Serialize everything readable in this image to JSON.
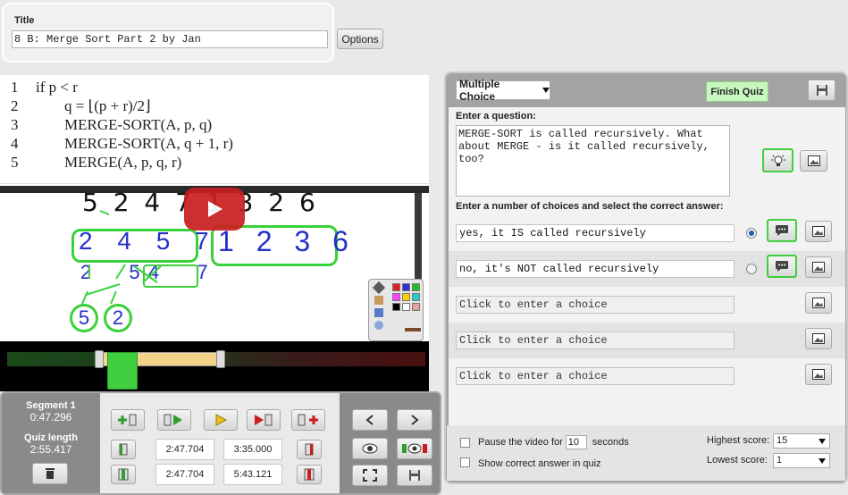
{
  "title_panel": {
    "label": "Title",
    "value": "8 B: Merge Sort Part 2 by Jan",
    "options_label": "Options"
  },
  "pseudocode": {
    "lines": [
      {
        "num": "1",
        "text": "if p < r"
      },
      {
        "num": "2",
        "text": "q = ⌊(p + r)/2⌋"
      },
      {
        "num": "3",
        "text": "MERGE-SORT(A, p, q)"
      },
      {
        "num": "4",
        "text": "MERGE-SORT(A, q + 1, r)"
      },
      {
        "num": "5",
        "text": "MERGE(A, p, q, r)"
      }
    ]
  },
  "segment": {
    "label": "Segment 1",
    "time": "0:47.296",
    "quiz_length_label": "Quiz length",
    "quiz_length": "2:55.417"
  },
  "timeline_fields": {
    "row1_start": "2:47.704",
    "row1_end": "3:35.000",
    "row2_start": "2:47.704",
    "row2_end": "5:43.121"
  },
  "quiz": {
    "type_select": "Multiple Choice",
    "finish_label": "Finish Quiz",
    "question_label": "Enter a question:",
    "question_text": "MERGE-SORT is called recursively. What about MERGE - is it called recursively, too?",
    "choices_label": "Enter a number of choices and select the correct answer:",
    "choices": [
      {
        "text": "yes, it IS called recursively",
        "selected": true
      },
      {
        "text": "no, it's NOT called recursively",
        "selected": false
      },
      {
        "text": "Click to enter a choice"
      },
      {
        "text": "Click to enter a choice"
      },
      {
        "text": "Click to enter a choice"
      }
    ],
    "pause_label_a": "Pause the video for",
    "pause_value": "10",
    "pause_label_b": "seconds",
    "show_correct_label": "Show correct answer in quiz",
    "highest_label": "Highest score:",
    "highest_value": "15",
    "lowest_label": "Lowest score:",
    "lowest_value": "1"
  },
  "whiteboard": {
    "row1": "5 2 4 7 1 3 2 6",
    "box_a": "2 4 5 7",
    "box_b": "1 2 3 6",
    "row3a": "2 5",
    "row3b": "4 7",
    "row4a": "5",
    "row4b": "2"
  },
  "palette_colors": [
    "#e02020",
    "#3030d0",
    "#20c020",
    "#ff40ff",
    "#ffd000",
    "#20d0d0",
    "#000000",
    "#ffffff",
    "#e8a0a0",
    "#7a4b2a",
    "#cfcfcf"
  ],
  "accent": {
    "green": "#3fcf3f",
    "finish_bg": "#c8f7c0"
  }
}
